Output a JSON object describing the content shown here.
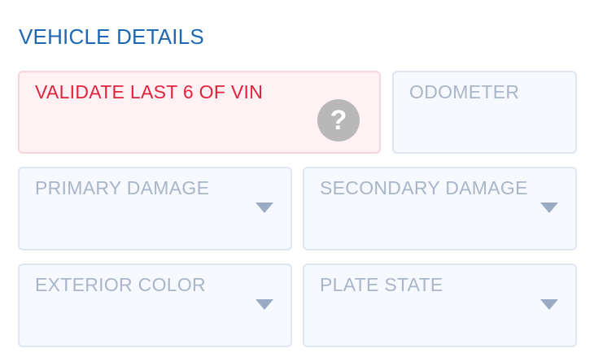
{
  "section": {
    "title": "VEHICLE DETAILS"
  },
  "fields": {
    "vin": {
      "label": "VALIDATE LAST 6 OF VIN",
      "help_icon": "question-circle-icon",
      "state": "error"
    },
    "odometer": {
      "label": "ODOMETER"
    },
    "primary_damage": {
      "label": "PRIMARY DAMAGE",
      "icon": "chevron-down-icon"
    },
    "secondary_damage": {
      "label": "SECONDARY DAMAGE",
      "icon": "chevron-down-icon"
    },
    "exterior_color": {
      "label": "EXTERIOR COLOR",
      "icon": "chevron-down-icon"
    },
    "plate_state": {
      "label": "PLATE STATE",
      "icon": "chevron-down-icon"
    }
  },
  "colors": {
    "title": "#1f67b3",
    "error_text": "#e0233b",
    "error_bg": "#fff1f4",
    "placeholder_text": "#a9b6c9",
    "field_bg": "#f6f9fe",
    "field_border": "#dfe6ef",
    "help_icon": "#b8b8b8"
  },
  "glyphs": {
    "help": "?"
  }
}
